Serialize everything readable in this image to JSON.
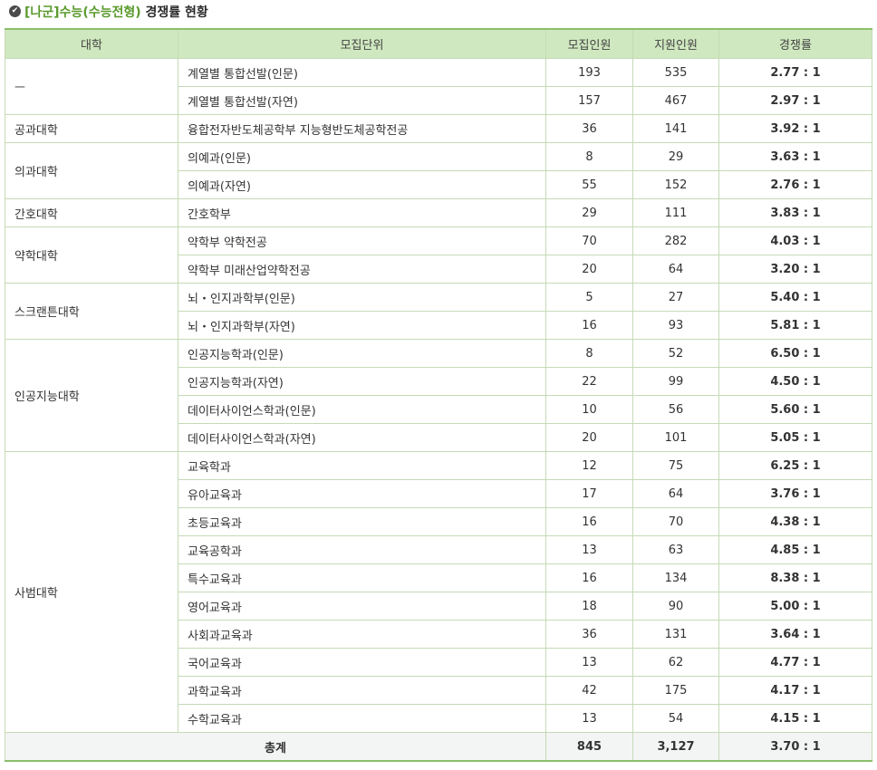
{
  "title": {
    "bracket": "[나군]수능(수능전형)",
    "rest": " 경쟁률 현황"
  },
  "columns": [
    "대학",
    "모집단위",
    "모집인원",
    "지원인원",
    "경쟁률"
  ],
  "groups": [
    {
      "univ": "ㅡ",
      "rows": [
        {
          "unit": "계열별 통합선발(인문)",
          "recruit": "193",
          "applicants": "535",
          "rate": "2.77 : 1"
        },
        {
          "unit": "계열별 통합선발(자연)",
          "recruit": "157",
          "applicants": "467",
          "rate": "2.97 : 1"
        }
      ]
    },
    {
      "univ": "공과대학",
      "rows": [
        {
          "unit": "융합전자반도체공학부 지능형반도체공학전공",
          "recruit": "36",
          "applicants": "141",
          "rate": "3.92 : 1"
        }
      ]
    },
    {
      "univ": "의과대학",
      "rows": [
        {
          "unit": "의예과(인문)",
          "recruit": "8",
          "applicants": "29",
          "rate": "3.63 : 1"
        },
        {
          "unit": "의예과(자연)",
          "recruit": "55",
          "applicants": "152",
          "rate": "2.76 : 1"
        }
      ]
    },
    {
      "univ": "간호대학",
      "rows": [
        {
          "unit": "간호학부",
          "recruit": "29",
          "applicants": "111",
          "rate": "3.83 : 1"
        }
      ]
    },
    {
      "univ": "약학대학",
      "rows": [
        {
          "unit": "약학부 약학전공",
          "recruit": "70",
          "applicants": "282",
          "rate": "4.03 : 1"
        },
        {
          "unit": "약학부 미래산업약학전공",
          "recruit": "20",
          "applicants": "64",
          "rate": "3.20 : 1"
        }
      ]
    },
    {
      "univ": "스크랜튼대학",
      "rows": [
        {
          "unit": "뇌・인지과학부(인문)",
          "recruit": "5",
          "applicants": "27",
          "rate": "5.40 : 1"
        },
        {
          "unit": "뇌・인지과학부(자연)",
          "recruit": "16",
          "applicants": "93",
          "rate": "5.81 : 1"
        }
      ]
    },
    {
      "univ": "인공지능대학",
      "rows": [
        {
          "unit": "인공지능학과(인문)",
          "recruit": "8",
          "applicants": "52",
          "rate": "6.50 : 1"
        },
        {
          "unit": "인공지능학과(자연)",
          "recruit": "22",
          "applicants": "99",
          "rate": "4.50 : 1"
        },
        {
          "unit": "데이터사이언스학과(인문)",
          "recruit": "10",
          "applicants": "56",
          "rate": "5.60 : 1"
        },
        {
          "unit": "데이터사이언스학과(자연)",
          "recruit": "20",
          "applicants": "101",
          "rate": "5.05 : 1"
        }
      ]
    },
    {
      "univ": "사범대학",
      "rows": [
        {
          "unit": "교육학과",
          "recruit": "12",
          "applicants": "75",
          "rate": "6.25 : 1"
        },
        {
          "unit": "유아교육과",
          "recruit": "17",
          "applicants": "64",
          "rate": "3.76 : 1"
        },
        {
          "unit": "초등교육과",
          "recruit": "16",
          "applicants": "70",
          "rate": "4.38 : 1"
        },
        {
          "unit": "교육공학과",
          "recruit": "13",
          "applicants": "63",
          "rate": "4.85 : 1"
        },
        {
          "unit": "특수교육과",
          "recruit": "16",
          "applicants": "134",
          "rate": "8.38 : 1"
        },
        {
          "unit": "영어교육과",
          "recruit": "18",
          "applicants": "90",
          "rate": "5.00 : 1"
        },
        {
          "unit": "사회과교육과",
          "recruit": "36",
          "applicants": "131",
          "rate": "3.64 : 1"
        },
        {
          "unit": "국어교육과",
          "recruit": "13",
          "applicants": "62",
          "rate": "4.77 : 1"
        },
        {
          "unit": "과학교육과",
          "recruit": "42",
          "applicants": "175",
          "rate": "4.17 : 1"
        },
        {
          "unit": "수학교육과",
          "recruit": "13",
          "applicants": "54",
          "rate": "4.15 : 1"
        }
      ]
    }
  ],
  "total": {
    "label": "총계",
    "recruit": "845",
    "applicants": "3,127",
    "rate": "3.70 : 1"
  }
}
